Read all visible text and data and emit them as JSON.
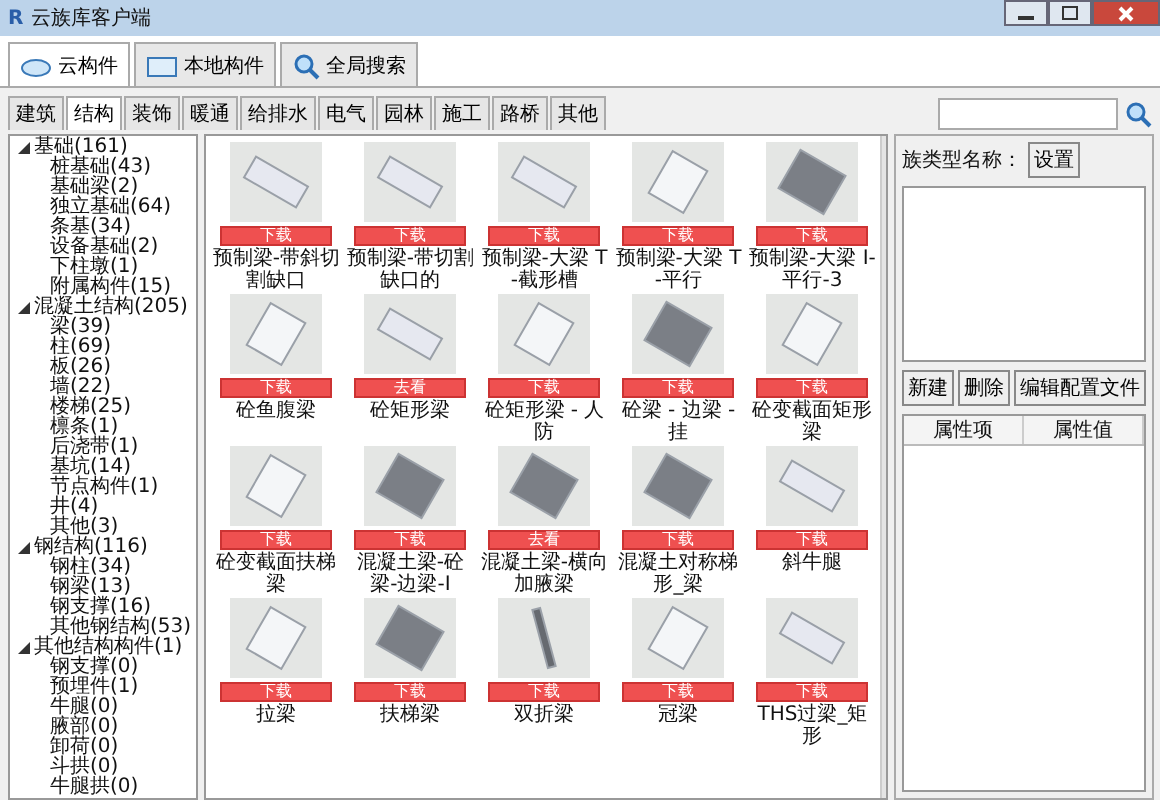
{
  "window": {
    "title": "云族库客户端",
    "logo": "R"
  },
  "main_tabs": [
    {
      "label": "云构件",
      "selected": true
    },
    {
      "label": "本地构件",
      "selected": false
    },
    {
      "label": "全局搜索",
      "selected": false
    }
  ],
  "category_tabs": [
    {
      "label": "建筑",
      "selected": false
    },
    {
      "label": "结构",
      "selected": true
    },
    {
      "label": "装饰",
      "selected": false
    },
    {
      "label": "暖通",
      "selected": false
    },
    {
      "label": "给排水",
      "selected": false
    },
    {
      "label": "电气",
      "selected": false
    },
    {
      "label": "园林",
      "selected": false
    },
    {
      "label": "施工",
      "selected": false
    },
    {
      "label": "路桥",
      "selected": false
    },
    {
      "label": "其他",
      "selected": false
    }
  ],
  "tree": [
    {
      "label": "基础(161)",
      "expanded": true,
      "children": [
        {
          "label": "桩基础(43)"
        },
        {
          "label": "基础梁(2)"
        },
        {
          "label": "独立基础(64)"
        },
        {
          "label": "条基(34)"
        },
        {
          "label": "设备基础(2)"
        },
        {
          "label": "下柱墩(1)"
        },
        {
          "label": "附属构件(15)"
        }
      ]
    },
    {
      "label": "混凝土结构(205)",
      "expanded": true,
      "children": [
        {
          "label": "梁(39)"
        },
        {
          "label": "柱(69)"
        },
        {
          "label": "板(26)"
        },
        {
          "label": "墙(22)"
        },
        {
          "label": "楼梯(25)"
        },
        {
          "label": "檩条(1)"
        },
        {
          "label": "后浇带(1)"
        },
        {
          "label": "基坑(14)"
        },
        {
          "label": "节点构件(1)"
        },
        {
          "label": "井(4)"
        },
        {
          "label": "其他(3)"
        }
      ]
    },
    {
      "label": "钢结构(116)",
      "expanded": true,
      "children": [
        {
          "label": "钢柱(34)"
        },
        {
          "label": "钢梁(13)"
        },
        {
          "label": "钢支撑(16)"
        },
        {
          "label": "其他钢结构(53)"
        }
      ]
    },
    {
      "label": "其他结构构件(1)",
      "expanded": true,
      "children": [
        {
          "label": "钢支撑(0)"
        },
        {
          "label": "预埋件(1)"
        },
        {
          "label": "牛腿(0)"
        },
        {
          "label": "腋部(0)"
        },
        {
          "label": "卸荷(0)"
        },
        {
          "label": "斗拱(0)"
        },
        {
          "label": "牛腿拱(0)"
        }
      ]
    }
  ],
  "components": [
    {
      "name": "预制梁-带斜切割缺口",
      "button": "下载",
      "kind": "block"
    },
    {
      "name": "预制梁-带切割缺口的",
      "button": "下载",
      "kind": "block"
    },
    {
      "name": "预制梁-大梁 T-截形槽",
      "button": "下载",
      "kind": "block"
    },
    {
      "name": "预制梁-大梁 T-平行",
      "button": "下载",
      "kind": "tall"
    },
    {
      "name": "预制梁-大梁 I-平行-3",
      "button": "下载",
      "kind": "dark"
    },
    {
      "name": "砼鱼腹梁",
      "button": "下载",
      "kind": "tall"
    },
    {
      "name": "砼矩形梁",
      "button": "去看",
      "kind": "block"
    },
    {
      "name": "砼矩形梁 - 人防",
      "button": "下载",
      "kind": "tall"
    },
    {
      "name": "砼梁 - 边梁 - 挂",
      "button": "下载",
      "kind": "dark"
    },
    {
      "name": "砼变截面矩形梁",
      "button": "下载",
      "kind": "tall"
    },
    {
      "name": "砼变截面扶梯梁",
      "button": "下载",
      "kind": "tall"
    },
    {
      "name": "混凝土梁-砼梁-边梁-I",
      "button": "下载",
      "kind": "dark"
    },
    {
      "name": "混凝土梁-横向加腋梁",
      "button": "去看",
      "kind": "dark"
    },
    {
      "name": "混凝土对称梯形_梁",
      "button": "下载",
      "kind": "dark"
    },
    {
      "name": "斜牛腿",
      "button": "下载",
      "kind": "block"
    },
    {
      "name": "拉梁",
      "button": "下载",
      "kind": "tall"
    },
    {
      "name": "扶梯梁",
      "button": "下载",
      "kind": "dark"
    },
    {
      "name": "双折梁",
      "button": "下载",
      "kind": "rod"
    },
    {
      "name": "冠梁",
      "button": "下载",
      "kind": "tall"
    },
    {
      "name": "THS过梁_矩形",
      "button": "下载",
      "kind": "block"
    }
  ],
  "right_panel": {
    "type_name_label": "族类型名称：",
    "settings_button": "设置",
    "buttons": [
      "新建",
      "删除",
      "编辑配置文件"
    ],
    "columns": [
      "属性项",
      "属性值"
    ]
  }
}
